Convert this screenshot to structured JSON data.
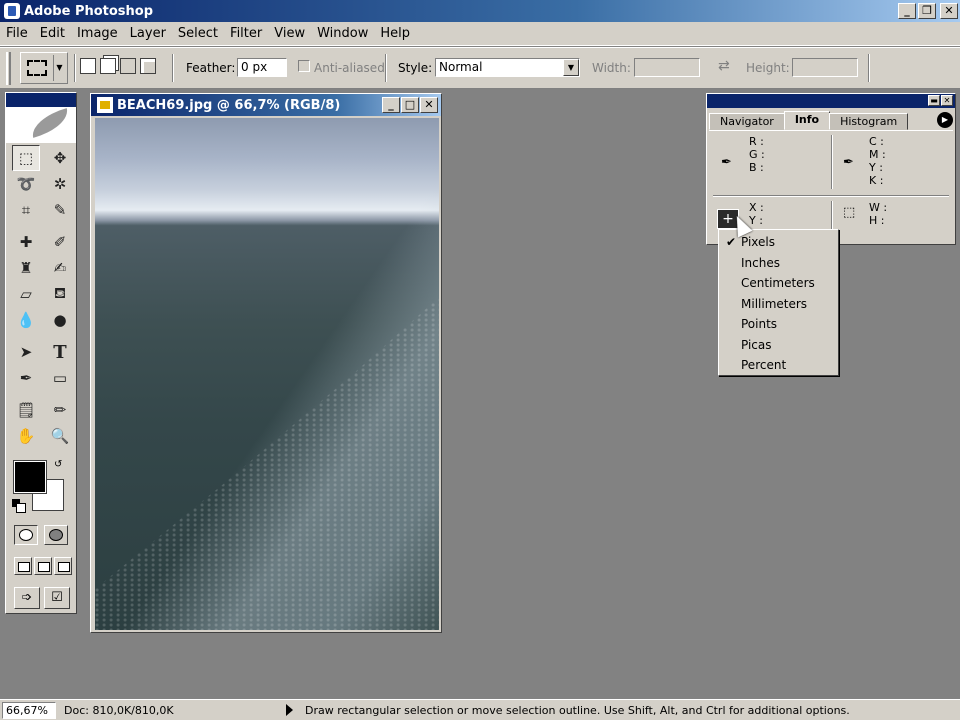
{
  "window": {
    "title": "Adobe Photoshop"
  },
  "menu": [
    "File",
    "Edit",
    "Image",
    "Layer",
    "Select",
    "Filter",
    "View",
    "Window",
    "Help"
  ],
  "options": {
    "feather_label": "Feather:",
    "feather_value": "0 px",
    "antialias_label": "Anti-aliased",
    "style_label": "Style:",
    "style_value": "Normal",
    "width_label": "Width:",
    "height_label": "Height:"
  },
  "document": {
    "title": "BEACH69.jpg @ 66,7% (RGB/8)"
  },
  "info_panel": {
    "tabs": [
      "Navigator",
      "Info",
      "Histogram"
    ],
    "active_tab": "Info",
    "rgb_labels": [
      "R :",
      "G :",
      "B :"
    ],
    "cmyk_labels": [
      "C :",
      "M :",
      "Y :",
      "K :"
    ],
    "xy_labels": [
      "X :",
      "Y :"
    ],
    "wh_labels": [
      "W :",
      "H :"
    ]
  },
  "units_menu": {
    "items": [
      "Pixels",
      "Inches",
      "Centimeters",
      "Millimeters",
      "Points",
      "Picas",
      "Percent"
    ],
    "checked": "Pixels"
  },
  "status": {
    "zoom": "66,67%",
    "doc_size": "Doc: 810,0K/810,0K",
    "message": "Draw rectangular selection or move selection outline.  Use Shift, Alt, and Ctrl for additional options."
  }
}
